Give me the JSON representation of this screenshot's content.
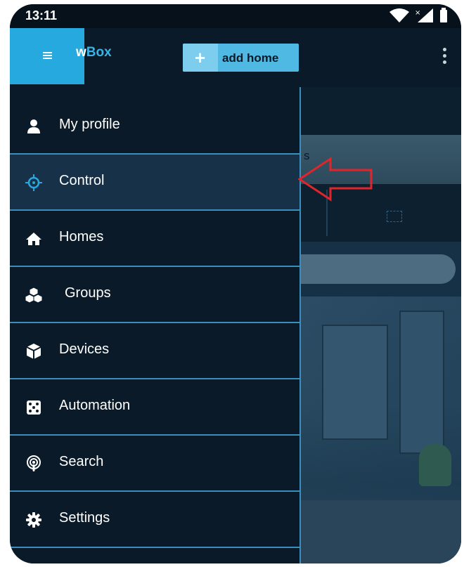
{
  "status_bar": {
    "time": "13:11",
    "icons": [
      "wifi-icon",
      "signal-icon",
      "battery-icon"
    ]
  },
  "app_bar": {
    "menu_icon": "hamburger-icon",
    "title_prefix": "w",
    "title_accent": "Box",
    "add_home_label": "add home",
    "add_home_icon": "plus-icon",
    "overflow_icon": "kebab-menu-icon"
  },
  "background": {
    "partial_text": "s"
  },
  "drawer": {
    "items": [
      {
        "label": "My profile",
        "icon": "user-icon",
        "active": false
      },
      {
        "label": "Control",
        "icon": "crosshair-icon",
        "active": true
      },
      {
        "label": "Homes",
        "icon": "home-icon",
        "active": false
      },
      {
        "label": "Groups",
        "icon": "cubes-icon",
        "active": false
      },
      {
        "label": "Devices",
        "icon": "cube-icon",
        "active": false
      },
      {
        "label": "Automation",
        "icon": "dice-icon",
        "active": false
      },
      {
        "label": "Search",
        "icon": "podcast-icon",
        "active": false
      },
      {
        "label": "Settings",
        "icon": "gear-icon",
        "active": false
      }
    ]
  },
  "colors": {
    "accent": "#26a9de",
    "drawer_bg": "#0b1a28",
    "divider": "#3a8fbf",
    "annotation": "#e0262b"
  }
}
